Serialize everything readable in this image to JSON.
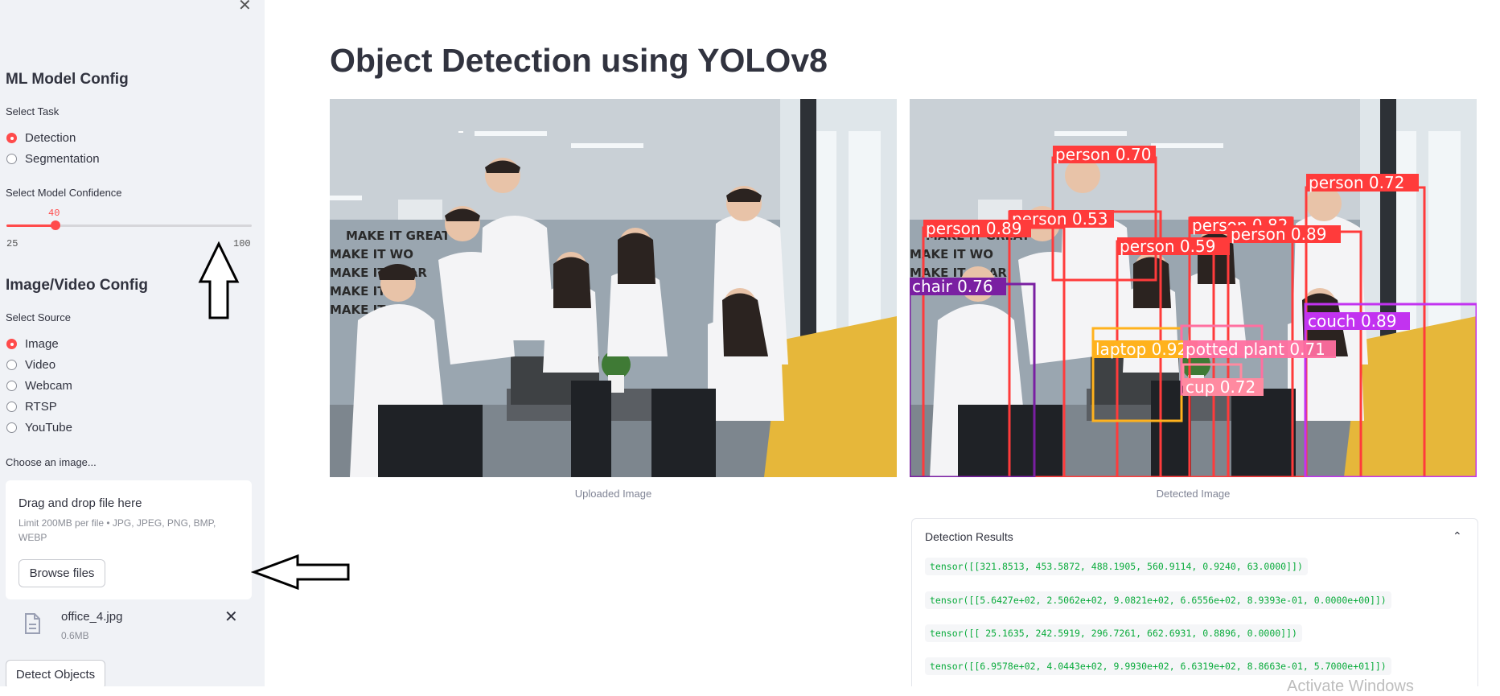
{
  "sidebar": {
    "close_glyph": "✕",
    "model_config": {
      "heading": "ML Model Config",
      "task_label": "Select Task",
      "tasks": [
        {
          "label": "Detection",
          "selected": true
        },
        {
          "label": "Segmentation",
          "selected": false
        }
      ],
      "confidence_label": "Select Model Confidence",
      "confidence": {
        "value": "40",
        "min": "25",
        "max": "100"
      }
    },
    "source_config": {
      "heading": "Image/Video Config",
      "source_label": "Select Source",
      "sources": [
        {
          "label": "Image",
          "selected": true
        },
        {
          "label": "Video",
          "selected": false
        },
        {
          "label": "Webcam",
          "selected": false
        },
        {
          "label": "RTSP",
          "selected": false
        },
        {
          "label": "YouTube",
          "selected": false
        }
      ]
    },
    "uploader": {
      "label": "Choose an image...",
      "drop_title": "Drag and drop file here",
      "limit_text": "Limit 200MB per file • JPG, JPEG, PNG, BMP, WEBP",
      "browse_label": "Browse files",
      "file": {
        "name": "office_4.jpg",
        "size": "0.6MB",
        "icon": "file-icon",
        "remove_glyph": "✕"
      }
    },
    "detect_button": "Detect Objects"
  },
  "main": {
    "title": "Object Detection using YOLOv8",
    "uploaded_caption": "Uploaded Image",
    "detected_caption": "Detected Image",
    "image_sign_text": [
      "MAKE IT GREAT",
      "MAKE IT WO",
      "MAKE IT SOAR",
      "MAKE IT HA",
      "MAKE IT FO"
    ],
    "detections": [
      {
        "label": "person 0.70",
        "color": "#ff3b3b"
      },
      {
        "label": "person 0.72",
        "color": "#ff3b3b"
      },
      {
        "label": "person 0.53",
        "color": "#ff3b3b"
      },
      {
        "label": "person 0.82",
        "color": "#ff3b3b"
      },
      {
        "label": "person 0.89",
        "color": "#ff3b3b"
      },
      {
        "label": "person 0.89",
        "color": "#ff3b3b"
      },
      {
        "label": "person 0.59",
        "color": "#ff3b3b"
      },
      {
        "label": "chair 0.76",
        "color": "#7a1fa2"
      },
      {
        "label": "couch 0.89",
        "color": "#c233f0"
      },
      {
        "label": "laptop 0.92",
        "color": "#ffb21d"
      },
      {
        "label": "potted plant 0.71",
        "color": "#ff6fa0"
      },
      {
        "label": "cup 0.72",
        "color": "#ff8aa0"
      }
    ],
    "results": {
      "heading": "Detection Results",
      "chevron": "⌃",
      "lines": [
        "tensor([[321.8513, 453.5872, 488.1905, 560.9114, 0.9240, 63.0000]])",
        "tensor([[5.6427e+02, 2.5062e+02, 9.0821e+02, 6.6556e+02, 8.9393e-01, 0.0000e+00]])",
        "tensor([[ 25.1635, 242.5919, 296.7261, 662.6931, 0.8896, 0.0000]])",
        "tensor([[6.9578e+02, 4.0443e+02, 9.9930e+02, 6.6319e+02, 8.8663e-01, 5.7000e+01]])"
      ]
    }
  },
  "annotations": {
    "up_arrow": "arrow-up-icon",
    "left_arrow": "arrow-left-icon"
  },
  "watermark": "Activate Windows",
  "colors": {
    "accent": "#ff4b4b",
    "sidebar_bg": "#f0f2f6",
    "code_green": "#09ab3b"
  }
}
